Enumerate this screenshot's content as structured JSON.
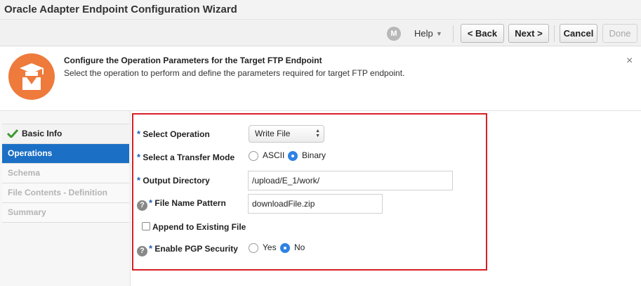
{
  "window": {
    "title": "Oracle Adapter Endpoint Configuration Wizard"
  },
  "toolbar": {
    "help_icon": "M",
    "help_label": "Help",
    "back_label": "< Back",
    "next_label": "Next >",
    "cancel_label": "Cancel",
    "done_label": "Done"
  },
  "header": {
    "title": "Configure the Operation Parameters for the Target FTP Endpoint",
    "description": "Select the operation to perform and define the parameters required for target FTP endpoint.",
    "close": "×"
  },
  "train": {
    "items": [
      {
        "label": "Basic Info",
        "state": "done"
      },
      {
        "label": "Operations",
        "state": "active"
      },
      {
        "label": "Schema",
        "state": "disabled"
      },
      {
        "label": "File Contents - Definition",
        "state": "disabled"
      },
      {
        "label": "Summary",
        "state": "disabled"
      }
    ]
  },
  "form": {
    "required_marker": "*",
    "help_marker": "?",
    "select_operation": {
      "label": "Select Operation",
      "value": "Write File"
    },
    "transfer_mode": {
      "label": "Select a Transfer Mode",
      "options": [
        "ASCII",
        "Binary"
      ],
      "selected": "Binary"
    },
    "output_directory": {
      "label": "Output Directory",
      "value": "/upload/E_1/work/"
    },
    "file_name_pattern": {
      "label": "File Name Pattern",
      "value": "downloadFile.zip"
    },
    "append": {
      "label": "Append to Existing File",
      "checked": false
    },
    "pgp_security": {
      "label": "Enable PGP Security",
      "options": [
        "Yes",
        "No"
      ],
      "selected": "No"
    }
  },
  "colors": {
    "accent": "#1b6fc5",
    "highlight_box": "#d71f26",
    "icon_bg": "#ee7a3c",
    "check": "#3c9a2e"
  }
}
